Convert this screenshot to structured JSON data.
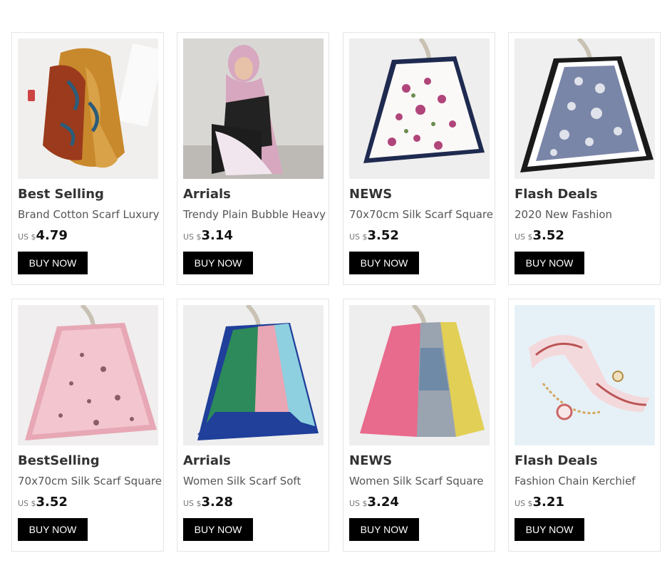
{
  "buy_label": "BUY NOW",
  "currency": "US $",
  "products": [
    {
      "category": "Best Selling",
      "title": "Brand Cotton Scarf Luxury",
      "price": "4.79"
    },
    {
      "category": "Arrials",
      "title": "Trendy Plain Bubble Heavy",
      "price": "3.14"
    },
    {
      "category": "NEWS",
      "title": "70x70cm Silk Scarf Square",
      "price": "3.52"
    },
    {
      "category": "Flash Deals",
      "title": "2020 New Fashion",
      "price": "3.52"
    },
    {
      "category": "BestSelling",
      "title": "70x70cm Silk Scarf Square",
      "price": "3.52"
    },
    {
      "category": "Arrials",
      "title": "Women Silk Scarf Soft",
      "price": "3.28"
    },
    {
      "category": "NEWS",
      "title": "Women Silk Scarf Square",
      "price": "3.24"
    },
    {
      "category": "Flash Deals",
      "title": "Fashion Chain Kerchief",
      "price": "3.21"
    }
  ]
}
